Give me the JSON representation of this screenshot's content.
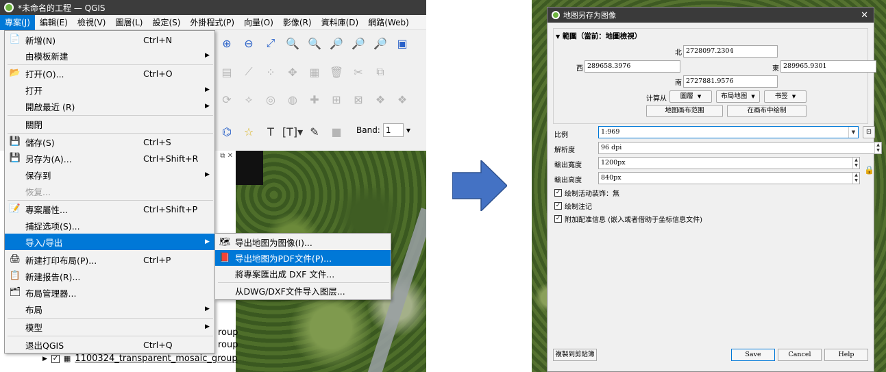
{
  "left": {
    "window_title": "*未命名的工程 — QGIS",
    "menubar": [
      {
        "label": "專案(J)",
        "active": true
      },
      {
        "label": "編輯(E)"
      },
      {
        "label": "檢視(V)"
      },
      {
        "label": "圖層(L)"
      },
      {
        "label": "設定(S)"
      },
      {
        "label": "外掛程式(P)"
      },
      {
        "label": "向量(O)"
      },
      {
        "label": "影像(R)"
      },
      {
        "label": "資料庫(D)"
      },
      {
        "label": "網路(Web)"
      }
    ],
    "file_menu": [
      {
        "icon": "📄",
        "label": "新增(N)",
        "shortcut": "Ctrl+N"
      },
      {
        "icon": "",
        "label": "由模板新建",
        "arrow": "▶"
      },
      {
        "icon": "📂",
        "label": "打开(O)...",
        "shortcut": "Ctrl+O"
      },
      {
        "icon": "",
        "label": "打开",
        "arrow": "▶"
      },
      {
        "icon": "",
        "label": "開啟最近 (R)",
        "arrow": "▶"
      },
      {
        "icon": "",
        "label": "關閉"
      },
      {
        "icon": "💾",
        "label": "儲存(S)",
        "shortcut": "Ctrl+S"
      },
      {
        "icon": "💾",
        "label": "另存为(A)...",
        "shortcut": "Ctrl+Shift+R"
      },
      {
        "icon": "",
        "label": "保存到",
        "arrow": "▶"
      },
      {
        "icon": "",
        "label": "恢复..."
      },
      {
        "icon": "📝",
        "label": "專案屬性...",
        "shortcut": "Ctrl+Shift+P"
      },
      {
        "icon": "",
        "label": "捕捉选项(S)..."
      },
      {
        "icon": "",
        "label": "导入/导出",
        "arrow": "▶"
      },
      {
        "icon": "🖨",
        "label": "新建打印布局(P)...",
        "shortcut": "Ctrl+P"
      },
      {
        "icon": "📋",
        "label": "新建报告(R)..."
      },
      {
        "icon": "🗂",
        "label": "布局管理器..."
      },
      {
        "icon": "",
        "label": "布局",
        "arrow": "▶"
      },
      {
        "icon": "",
        "label": "模型",
        "arrow": "▶"
      },
      {
        "icon": "",
        "label": "退出QGIS",
        "shortcut": "Ctrl+Q"
      }
    ],
    "submenu": [
      {
        "icon": "🗺",
        "label": "导出地图为图像(I)..."
      },
      {
        "icon": "📕",
        "label": "导出地图为PDF文件(P)..."
      },
      {
        "icon": "",
        "label": "將專案匯出成 DXF 文件..."
      },
      {
        "icon": "",
        "label": "从DWG/DXF文件导入图层..."
      }
    ],
    "band_label": "Band:",
    "band_value": "1",
    "layers": [
      {
        "label": "roup"
      },
      {
        "label": "roup"
      },
      {
        "label": "1100324_transparent_mosaic_group"
      }
    ]
  },
  "right": {
    "dialog_title": "地图另存为图像",
    "extent_header": "範圍（當前：地圖檢視）",
    "north_label": "北",
    "north_value": "2728097.2304",
    "west_label": "西",
    "west_value": "289658.3976",
    "east_label": "東",
    "east_value": "289965.9301",
    "south_label": "南",
    "south_value": "2727881.9576",
    "calc_from": "计算从",
    "layer_btn": "圖層",
    "layout_btn": "布局地图",
    "bookmark_btn": "书签",
    "canvas_extent_btn": "地图画布范围",
    "draw_on_canvas_btn": "在画布中绘制",
    "scale_label": "比例",
    "scale_value": "1:969",
    "resolution_label": "解析度",
    "resolution_value": "96 dpi",
    "width_label": "輸出寬度",
    "width_value": "1200px",
    "height_label": "輸出高度",
    "height_value": "840px",
    "cb1": "绘制活动装饰：無",
    "cb2": "绘制注记",
    "cb3": "附加配准信息 (嵌入或者借助于坐标信息文件)",
    "copy_btn": "複製到剪貼簿",
    "save_btn": "Save",
    "cancel_btn": "Cancel",
    "help_btn": "Help"
  },
  "colors": {
    "highlight": "#0078d7",
    "arrow": "#4472c4"
  }
}
